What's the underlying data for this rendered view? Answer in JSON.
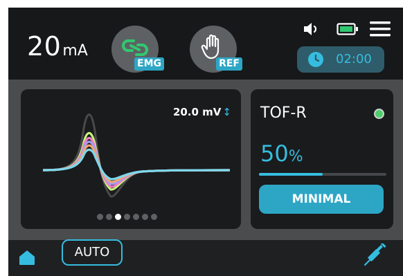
{
  "header": {
    "current_value": "20",
    "current_unit": "mA",
    "modes": [
      {
        "label": "EMG",
        "icon": "link-icon",
        "color": "#31c870"
      },
      {
        "label": "REF",
        "icon": "hand-icon",
        "color": "#ffffff"
      }
    ],
    "status_icons": [
      "speaker-icon",
      "battery-icon",
      "menu-icon"
    ],
    "timer": {
      "icon": "clock-icon",
      "time": "02:00"
    }
  },
  "emg": {
    "scale": "20.0 mV",
    "scale_icon": "vertical-double-arrow-icon",
    "waveform_colors": [
      "#4a4a4a",
      "#c6f27c",
      "#f07cc8",
      "#a49cf2",
      "#f4a46c",
      "#7ad9ee"
    ],
    "pager": {
      "count": 7,
      "active_index": 2
    }
  },
  "tof": {
    "label": "TOF-R",
    "status_color": "#4fce6b",
    "value": "50",
    "unit": "%",
    "progress": 0.5,
    "result_button": "MINIMAL"
  },
  "footer": {
    "home_icon": "home-icon",
    "auto_label": "AUTO",
    "syringe_icon": "syringe-icon"
  },
  "colors": {
    "accent": "#35bde0",
    "accent_button": "#2da6c6",
    "background": "#16181a",
    "panel": "#1a1b1d"
  }
}
